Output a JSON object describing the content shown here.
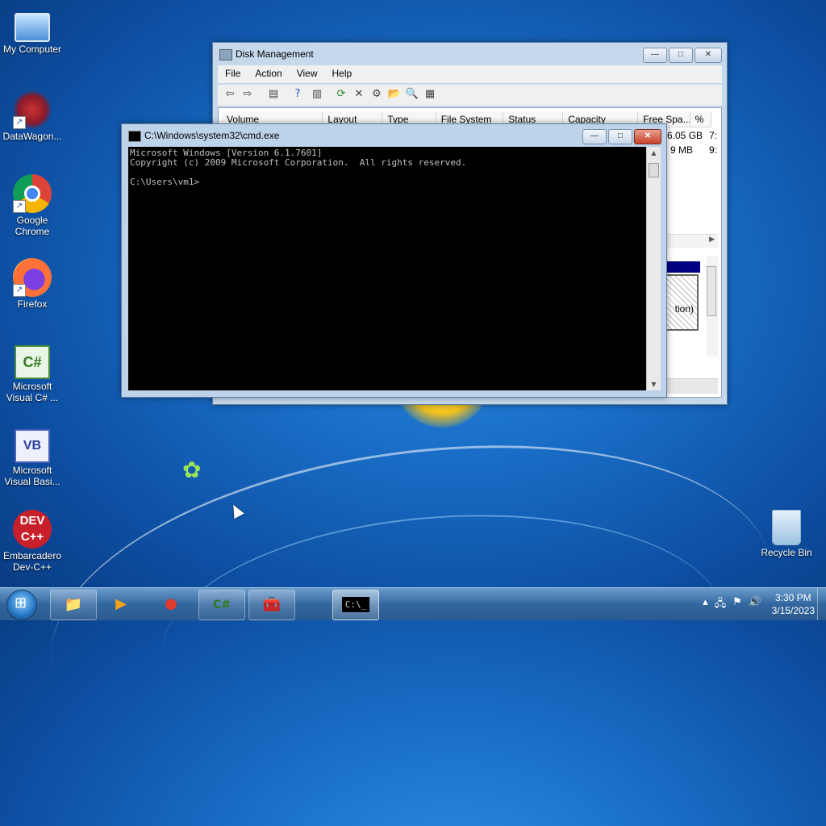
{
  "desktop": {
    "icons": [
      {
        "label": "My Computer",
        "icon": "computer-icon"
      },
      {
        "label": "DataWagon...",
        "icon": "datawagon-icon"
      },
      {
        "label": "Google Chrome",
        "icon": "chrome-icon"
      },
      {
        "label": "Firefox",
        "icon": "firefox-icon"
      },
      {
        "label": "Microsoft Visual C# ...",
        "icon": "visual-csharp-icon",
        "glyph": "C#"
      },
      {
        "label": "Microsoft Visual Basi...",
        "icon": "visual-basic-icon",
        "glyph": "VB"
      },
      {
        "label": "Embarcadero Dev-C++",
        "icon": "devcpp-icon",
        "glyph": "DEV\nC++"
      },
      {
        "label": "Recycle Bin",
        "icon": "recycle-bin-icon"
      }
    ]
  },
  "disk_management": {
    "title": "Disk Management",
    "menu": [
      "File",
      "Action",
      "View",
      "Help"
    ],
    "columns": [
      "Volume",
      "Layout",
      "Type",
      "File System",
      "Status",
      "Capacity",
      "Free Spa...",
      "%"
    ],
    "visible_cells": [
      {
        "free": "6.05 GB",
        "pct": "7:"
      },
      {
        "free": "9 MB",
        "pct": "9:"
      }
    ],
    "partition_text": "tion)"
  },
  "cmd": {
    "title": "C:\\Windows\\system32\\cmd.exe",
    "lines": [
      "Microsoft Windows [Version 6.1.7601]",
      "Copyright (c) 2009 Microsoft Corporation.  All rights reserved.",
      "",
      "C:\\Users\\vm1>"
    ]
  },
  "taskbar": {
    "time": "3:30 PM",
    "date": "3/15/2023",
    "buttons": [
      {
        "name": "explorer",
        "glyph": "📁"
      },
      {
        "name": "media-player",
        "glyph": "▶"
      },
      {
        "name": "chrome",
        "glyph": "●"
      },
      {
        "name": "visual-csharp",
        "glyph": "C#"
      },
      {
        "name": "toolbox",
        "glyph": "🧰"
      },
      {
        "name": "cmd",
        "glyph": "C:\\_"
      }
    ]
  },
  "window_controls": {
    "minimize": "—",
    "maximize": "□",
    "close": "✕"
  }
}
